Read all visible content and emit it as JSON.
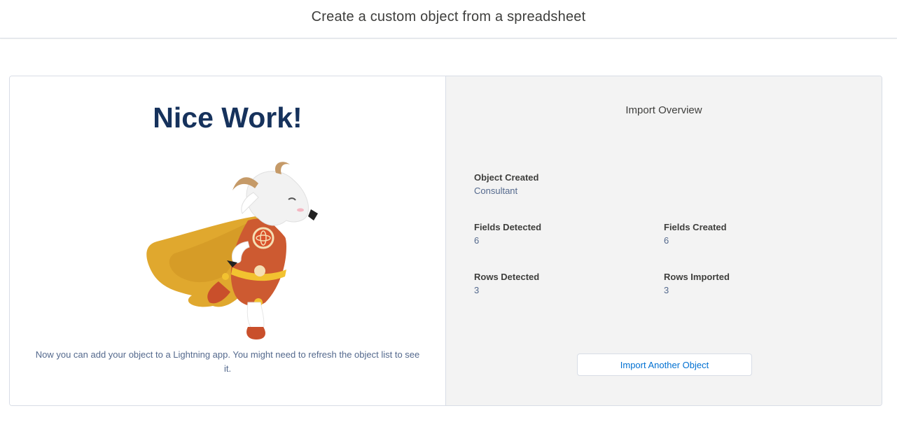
{
  "header": {
    "title": "Create a custom object from a spreadsheet"
  },
  "success_panel": {
    "headline": "Nice Work!",
    "message": "Now you can add your object to a Lightning app. You might need to refresh the object list to see it.",
    "illustration_icon": "superhero-goat-mascot"
  },
  "overview": {
    "title": "Import Overview",
    "object_created": {
      "label": "Object Created",
      "value": "Consultant"
    },
    "fields_detected": {
      "label": "Fields Detected",
      "value": "6"
    },
    "fields_created": {
      "label": "Fields Created",
      "value": "6"
    },
    "rows_detected": {
      "label": "Rows Detected",
      "value": "3"
    },
    "rows_imported": {
      "label": "Rows Imported",
      "value": "3"
    },
    "import_another_label": "Import Another Object"
  },
  "colors": {
    "headline": "#16325c",
    "link": "#0070d2",
    "panel_bg": "#f3f3f3",
    "border": "#d8dde6"
  }
}
